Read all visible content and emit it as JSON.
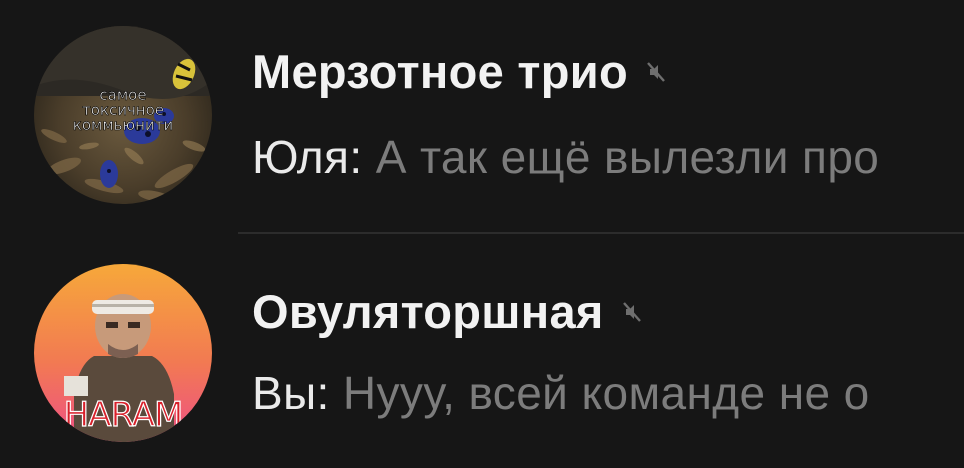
{
  "chats": [
    {
      "title": "Мерзотное трио",
      "avatar_icon": "group-avatar-frog",
      "avatar_text": [
        "самое",
        "токсичное",
        "коммьюнити"
      ],
      "muted": true,
      "mute_icon": "muted-speaker-icon",
      "sender": "Юля:",
      "message": "А так ещё вылезли про"
    },
    {
      "title": "Овуляторшная",
      "avatar_icon": "group-avatar-haram",
      "avatar_text": [
        "HARAM"
      ],
      "muted": true,
      "mute_icon": "muted-speaker-icon",
      "sender": "Вы:",
      "message": "Нууу, всей команде не о"
    }
  ],
  "colors": {
    "background": "#161616",
    "title": "#f2f2f2",
    "sender": "#eaeaea",
    "message": "#7c7c7c",
    "divider": "#2c2c2c",
    "mute_icon": "#6e6e6e"
  }
}
